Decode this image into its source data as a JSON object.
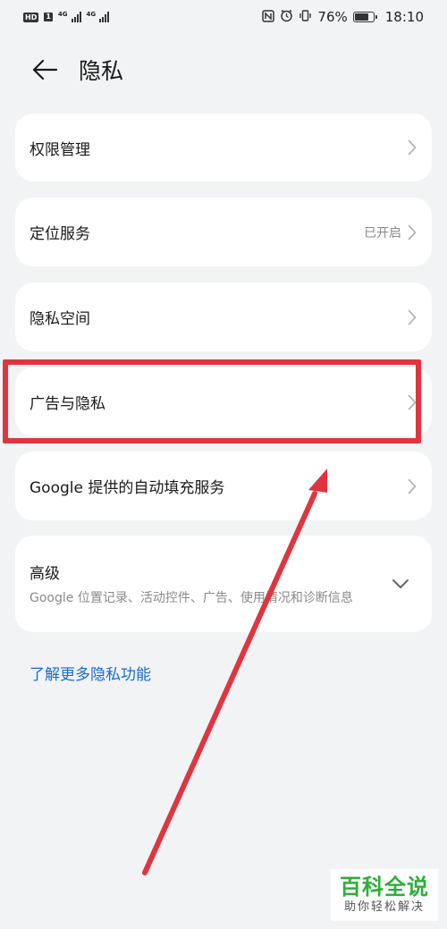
{
  "status_bar": {
    "left_badges": [
      "HD",
      "1"
    ],
    "net_1": "4G",
    "net_2": "4G",
    "battery_percent": "76%",
    "battery_level": 0.76,
    "time": "18:10",
    "icons": [
      "nfc-icon",
      "alarm-icon",
      "vibrate-icon"
    ]
  },
  "header": {
    "title": "隐私",
    "back_icon": "arrow-left-icon"
  },
  "items": [
    {
      "label": "权限管理",
      "value": ""
    },
    {
      "label": "定位服务",
      "value": "已开启"
    },
    {
      "label": "隐私空间",
      "value": ""
    },
    {
      "label": "广告与隐私",
      "value": ""
    },
    {
      "label": "Google 提供的自动填充服务",
      "value": ""
    }
  ],
  "advanced": {
    "title": "高级",
    "description": "Google 位置记录、活动控件、广告、使用情况和诊断信息"
  },
  "learn_more": "了解更多隐私功能",
  "watermark": {
    "title": "百科全说",
    "subtitle": "助你轻松解决"
  },
  "colors": {
    "background": "#f1f3f5",
    "card": "#ffffff",
    "link": "#1a6ccf",
    "highlight": "#e0353f",
    "watermark_green": "#2fae3a"
  }
}
